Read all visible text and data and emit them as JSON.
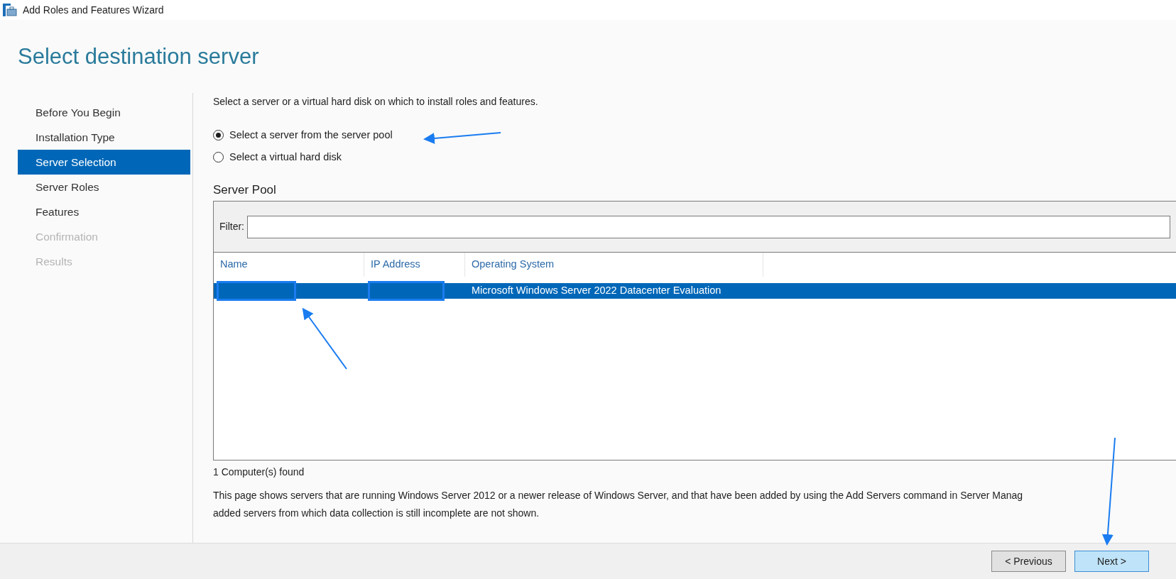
{
  "window": {
    "title": "Add Roles and Features Wizard"
  },
  "heading": "Select destination server",
  "sidebar": {
    "items": [
      {
        "label": "Before You Begin",
        "selected": false,
        "disabled": false
      },
      {
        "label": "Installation Type",
        "selected": false,
        "disabled": false
      },
      {
        "label": "Server Selection",
        "selected": true,
        "disabled": false
      },
      {
        "label": "Server Roles",
        "selected": false,
        "disabled": false
      },
      {
        "label": "Features",
        "selected": false,
        "disabled": false
      },
      {
        "label": "Confirmation",
        "selected": false,
        "disabled": true
      },
      {
        "label": "Results",
        "selected": false,
        "disabled": true
      }
    ]
  },
  "description": "Select a server or a virtual hard disk on which to install roles and features.",
  "options": [
    {
      "label": "Select a server from the server pool",
      "selected": true
    },
    {
      "label": "Select a virtual hard disk",
      "selected": false
    }
  ],
  "server_pool": {
    "title": "Server Pool",
    "filter_label": "Filter:",
    "columns": [
      "Name",
      "IP Address",
      "Operating System"
    ],
    "rows": [
      {
        "selected": true,
        "os": "Microsoft Windows Server 2022 Datacenter Evaluation"
      }
    ],
    "count": "1 Computer(s) found"
  },
  "note_lines": [
    "This page shows servers that are running Windows Server 2012 or a newer release of Windows Server, and that have been added by using the Add Servers command in Server Manag",
    "added servers from which data collection is still incomplete are not shown."
  ],
  "buttons": [
    {
      "label": "< Previous",
      "selected": false
    },
    {
      "label": "Next >",
      "selected": true
    }
  ]
}
